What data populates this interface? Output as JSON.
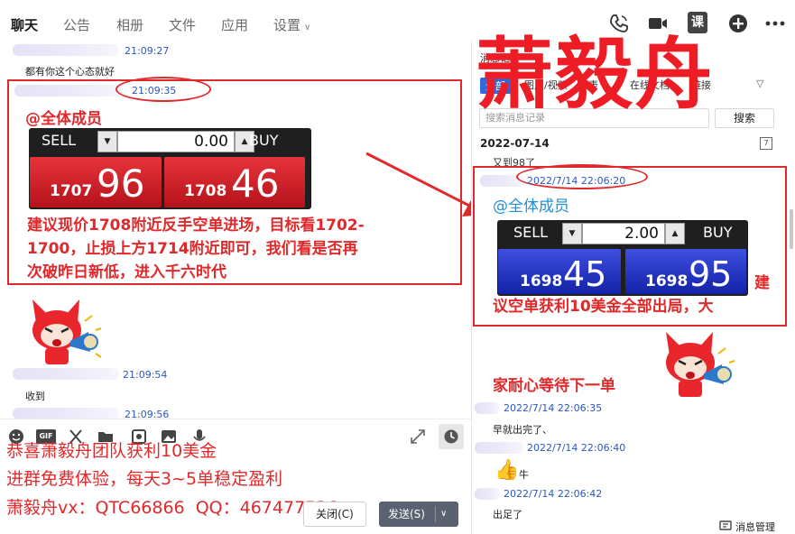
{
  "nav": {
    "tabs": [
      {
        "label": "聊天"
      },
      {
        "label": "公告"
      },
      {
        "label": "相册"
      },
      {
        "label": "文件"
      },
      {
        "label": "应用"
      },
      {
        "label": "设置"
      }
    ],
    "course_label": "课",
    "icons": [
      "phone-icon",
      "video-icon",
      "course-icon",
      "add-icon",
      "more-icon"
    ]
  },
  "left_chat": {
    "messages": [
      {
        "time": "21:09:27",
        "text": "都有你这个心态就好"
      },
      {
        "time": "21:09:35"
      },
      {
        "time": "21:09:54",
        "text": "收到"
      },
      {
        "time": "21:09:56"
      }
    ],
    "mention": "@全体成员",
    "advice": "建议现价1708附近反手空单进场，目标看1702-1700，止损上方1714附近即可，我们看是否再次破昨日新低，进入千六时代",
    "advice_lines": [
      "建议现价1708附近反手空单进场，目标看1702-",
      "1700，止损上方1714附近即可，我们看是否再",
      "次破昨日新低，进入千六时代"
    ],
    "trade_widget": {
      "sell_label": "SELL",
      "buy_label": "BUY",
      "lot": "0.00",
      "sell_small": "1707",
      "sell_big": "96",
      "buy_small": "1708",
      "buy_big": "46",
      "color": "#c9141d"
    }
  },
  "input_area": {
    "gif_label": "GIF",
    "promo_lines": [
      "恭喜萧毅舟团队获利10美金",
      "进群免费体验，每天3~5单稳定盈利",
      "萧毅舟vx：QTC66866  QQ：467477536"
    ],
    "close_label": "关闭(C)",
    "send_label": "发送(S)",
    "send_dropdown": "∨"
  },
  "right_pane": {
    "header_text": "消息记录",
    "tabs": [
      "全部",
      "图片/视频",
      "表",
      "在线文档",
      "链接"
    ],
    "search_placeholder": "搜索消息记录",
    "search_button": "搜索",
    "date": "2022-07-14",
    "cut_message": "又到98了",
    "big_title": "萧毅舟",
    "messages": [
      {
        "time": "2022/7/14 22:06:20"
      },
      {
        "time": "2022/7/14 22:06:35",
        "text": "早就出完了、"
      },
      {
        "time": "2022/7/14 22:06:40",
        "text": "牛"
      },
      {
        "time": "2022/7/14 22:06:42",
        "text": "出足了"
      }
    ],
    "mention": "@全体成员",
    "result_lines": [
      "建",
      "议空单获利10美金全部出局，大"
    ],
    "patience": "家耐心等待下一单",
    "trade_widget": {
      "sell_label": "SELL",
      "buy_label": "BUY",
      "lot": "2.00",
      "sell_small": "1698",
      "sell_big": "45",
      "buy_small": "1698",
      "buy_big": "95",
      "color": "#1a2bc0"
    },
    "message_manager": "消息管理"
  },
  "colors": {
    "accent_red": "#e0292b",
    "link_blue": "#2a56c6",
    "title_red": "#ee1c25"
  }
}
